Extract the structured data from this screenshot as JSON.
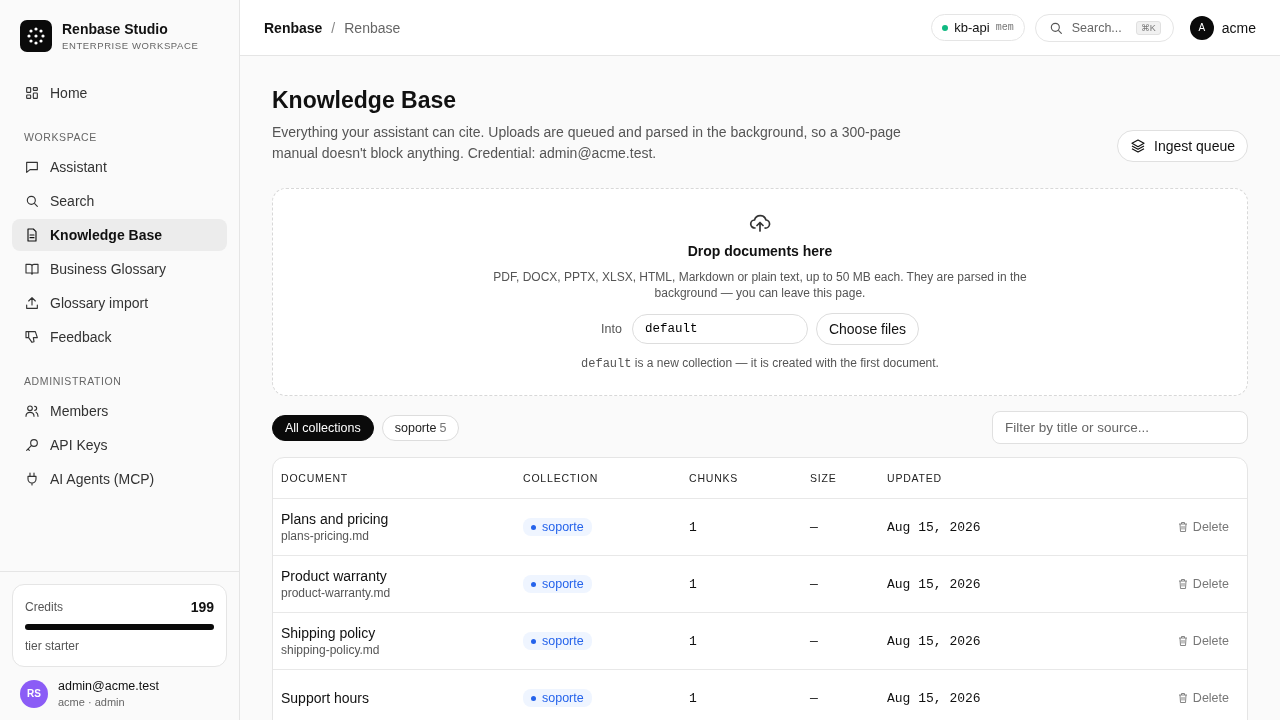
{
  "brand": {
    "name": "Renbase Studio",
    "subtitle": "ENTERPRISE WORKSPACE"
  },
  "sidebar": {
    "sections": [
      {
        "items": [
          {
            "label": "Home",
            "kind": "grid",
            "selected": false
          }
        ]
      },
      {
        "heading": "WORKSPACE",
        "items": [
          {
            "label": "Assistant",
            "kind": "chat",
            "selected": false
          },
          {
            "label": "Search",
            "kind": "search",
            "selected": false
          },
          {
            "label": "Knowledge Base",
            "kind": "doc",
            "selected": true
          },
          {
            "label": "Business Glossary",
            "kind": "book",
            "selected": false
          },
          {
            "label": "Glossary import",
            "kind": "upload",
            "selected": false
          },
          {
            "label": "Feedback",
            "kind": "thumbdown",
            "selected": false
          }
        ]
      },
      {
        "heading": "ADMINISTRATION",
        "items": [
          {
            "label": "Members",
            "kind": "users",
            "selected": false
          },
          {
            "label": "API Keys",
            "kind": "key",
            "selected": false
          },
          {
            "label": "AI Agents (MCP)",
            "kind": "plug",
            "selected": false
          }
        ]
      }
    ],
    "credits": {
      "label": "Credits",
      "value": "199",
      "level": 1,
      "tier": "tier starter"
    },
    "user": {
      "initials": "RS",
      "email": "admin@acme.test",
      "role": "acme · admin"
    }
  },
  "topbar": {
    "breadcrumb": [
      "Renbase",
      "Renbase"
    ],
    "breadcrumb_separator": "/",
    "service": {
      "name": "kb-api",
      "tag": "mem",
      "color": "#10b981"
    },
    "search": {
      "placeholder": "Search...",
      "shortcut": "⌘K"
    },
    "account": {
      "initial": "A",
      "name": "acme"
    }
  },
  "page": {
    "title": "Knowledge Base",
    "description": "Everything your assistant can cite. Uploads are queued and parsed in the background, so a 300-page manual doesn't block anything. Credential: admin@acme.test.",
    "queue_button": "Ingest queue"
  },
  "dropzone": {
    "title": "Drop documents here",
    "hint": "PDF, DOCX, PPTX, XLSX, HTML, Markdown or plain text, up to 50 MB each. They are parsed in the background — you can leave this page.",
    "into_label": "Into",
    "collection_value": "default",
    "choose_button": "Choose files",
    "note_code": "default",
    "note_text": "is a new collection — it is created with the first document."
  },
  "filters": {
    "chips": [
      {
        "label": "All collections",
        "selected": true
      },
      {
        "label": "soporte",
        "count": "5",
        "selected": false
      }
    ],
    "filter_placeholder": "Filter by title or source..."
  },
  "table": {
    "columns": [
      "DOCUMENT",
      "COLLECTION",
      "CHUNKS",
      "SIZE",
      "UPDATED"
    ],
    "rows": [
      {
        "title": "Plans and pricing",
        "source": "plans-pricing.md",
        "collection": "soporte",
        "color": "#2563eb",
        "chunks": "1",
        "size": "—",
        "updated": "Aug 15, 2026",
        "action": "Delete"
      },
      {
        "title": "Product warranty",
        "source": "product-warranty.md",
        "collection": "soporte",
        "color": "#2563eb",
        "chunks": "1",
        "size": "—",
        "updated": "Aug 15, 2026",
        "action": "Delete"
      },
      {
        "title": "Shipping policy",
        "source": "shipping-policy.md",
        "collection": "soporte",
        "color": "#2563eb",
        "chunks": "1",
        "size": "—",
        "updated": "Aug 15, 2026",
        "action": "Delete"
      },
      {
        "title": "Support hours",
        "collection": "soporte",
        "color": "#2563eb",
        "chunks": "1",
        "size": "—",
        "updated": "Aug 15, 2026",
        "action": "Delete"
      }
    ]
  }
}
